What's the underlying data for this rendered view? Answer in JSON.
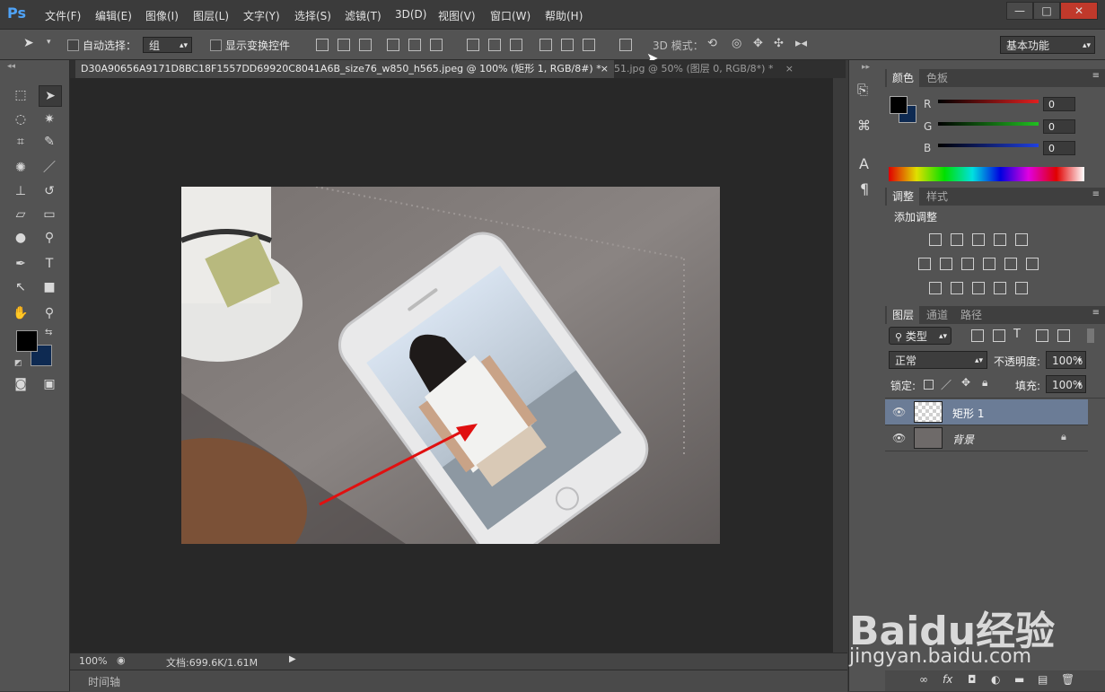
{
  "app": {
    "logo": "Ps"
  },
  "menu": [
    "文件(F)",
    "编辑(E)",
    "图像(I)",
    "图层(L)",
    "文字(Y)",
    "选择(S)",
    "滤镜(T)",
    "3D(D)",
    "视图(V)",
    "窗口(W)",
    "帮助(H)"
  ],
  "window_buttons": {
    "minimize": "—",
    "maximize": "□",
    "close": "✕"
  },
  "options": {
    "auto_select_label": "自动选择：",
    "auto_select_value": "组",
    "show_transform_label": "显示变换控件",
    "mode_3d_label": "3D 模式：",
    "workspace": "基本功能"
  },
  "tabs": [
    {
      "label": "D30A90656A9171D8BC18F1557DD69920C8041A6B_size76_w850_h565.jpeg @ 100% (矩形 1, RGB/8#) *",
      "close": "×"
    },
    {
      "label": "51.jpg @ 50% (图层 0, RGB/8*) *",
      "close": "×"
    }
  ],
  "status": {
    "zoom": "100%",
    "doc": "文档:699.6K/1.61M",
    "timeline": "时间轴"
  },
  "color_panel": {
    "tabs": [
      "颜色",
      "色板"
    ],
    "channels": [
      {
        "name": "R",
        "value": "0",
        "color": "#e02020"
      },
      {
        "name": "G",
        "value": "0",
        "color": "#20c020"
      },
      {
        "name": "B",
        "value": "0",
        "color": "#2040e0"
      }
    ]
  },
  "adjust_panel": {
    "tabs": [
      "调整",
      "样式"
    ],
    "title": "添加调整"
  },
  "layers_panel": {
    "tabs": [
      "图层",
      "通道",
      "路径"
    ],
    "filter": "类型",
    "blend": "正常",
    "opacity_label": "不透明度:",
    "opacity": "100%",
    "lock_label": "锁定:",
    "fill_label": "填充:",
    "fill": "100%",
    "layers": [
      {
        "name": "矩形 1",
        "selected": true
      },
      {
        "name": "背景",
        "selected": false,
        "locked": true
      }
    ]
  },
  "foreground_color": "#000000",
  "background_color": "#0e2a52",
  "watermark": {
    "brand": "Baidu经验",
    "url": "jingyan.baidu.com"
  }
}
